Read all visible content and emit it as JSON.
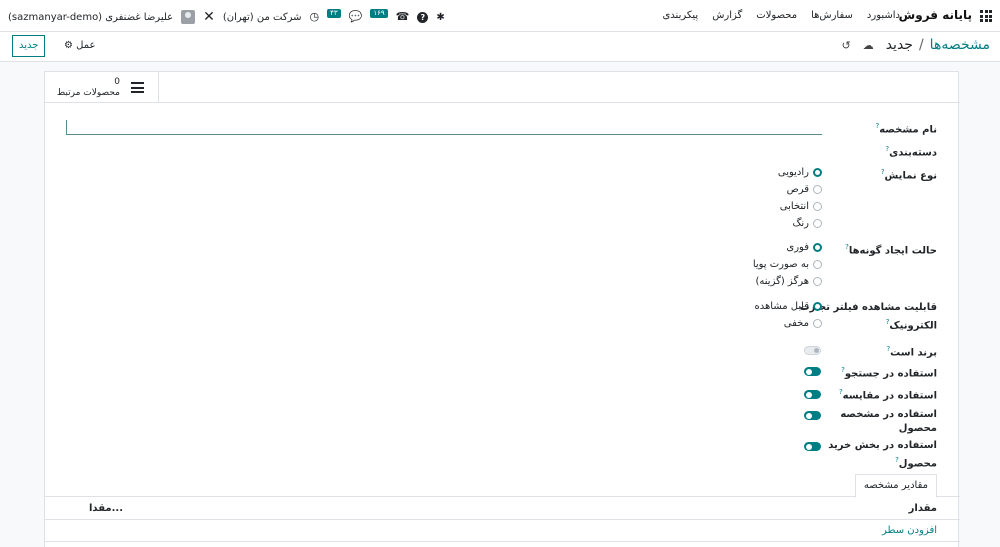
{
  "navbar": {
    "brand": "پایانه فروش",
    "menu": [
      "داشبورد",
      "سفارش‌ها",
      "محصولات",
      "گزارش",
      "پیکربندی"
    ],
    "user_name": "(sazmanyar-demo) علیرضا غضنفری",
    "company": "شرکت من (تهران)",
    "activity_badge": "۴۳",
    "messages_badge": "۱۶۹"
  },
  "control": {
    "new_button": "جدید",
    "action_label": "عمل",
    "breadcrumb_parent": "مشخصه‌ها",
    "breadcrumb_sep": "/",
    "breadcrumb_current": "جدید"
  },
  "button_box": {
    "related_products_value": "0",
    "related_products_label": "محصولات مرتبط"
  },
  "form": {
    "attribute_name_label": "نام مشخصه",
    "category_label": "دسته‌بندی",
    "display_type_label": "نوع نمایش",
    "display_type_options": [
      "رادیویی",
      "قرص",
      "انتخابی",
      "رنگ"
    ],
    "display_type_selected": 0,
    "variants_creation_label": "حالت ایجاد گونه‌ها",
    "variants_creation_options": [
      "فوری",
      "به صورت پویا",
      "هرگز (گزینه)"
    ],
    "variants_creation_selected": 0,
    "ecommerce_filter_label_line1": "قابلیت مشاهده فیلتر تجارت",
    "ecommerce_filter_label_line2": "الکترونیک",
    "ecommerce_filter_options": [
      "قابل مشاهده",
      "مخفی"
    ],
    "ecommerce_filter_selected": 0,
    "is_brand_label": "برند است",
    "is_brand_value": false,
    "use_search_label": "استفاده در جستجو",
    "use_search_value": true,
    "use_compare_label": "استفاده در مقایسه",
    "use_compare_value": true,
    "use_product_attr_label_line1": "استفاده در مشخصه",
    "use_product_attr_label_line2": "محصول",
    "use_product_attr_value": true,
    "use_purchase_label_line1": "استفاده در بخش خرید",
    "use_purchase_label_line2": "محصول",
    "use_purchase_value": true,
    "help_mark": "?"
  },
  "tabs": {
    "values_tab": "مقادیر مشخصه"
  },
  "values_list": {
    "column_value": "مقدار",
    "column_truncated": "مقدا...",
    "add_line": "افزودن سطر"
  },
  "colors": {
    "accent": "#017e84"
  }
}
